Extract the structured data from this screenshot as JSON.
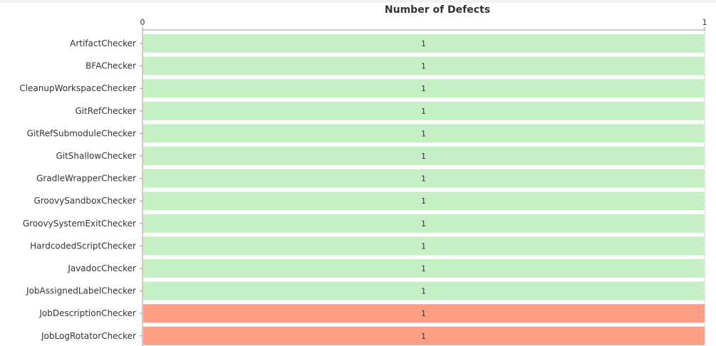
{
  "chart_data": {
    "type": "bar",
    "orientation": "horizontal",
    "xlabel": "Number of Defects",
    "xlim": [
      0,
      1
    ],
    "ticks": [
      "0",
      "1"
    ],
    "grid": false,
    "categories": [
      "ArtifactChecker",
      "BFAChecker",
      "CleanupWorkspaceChecker",
      "GitRefChecker",
      "GitRefSubmoduleChecker",
      "GitShallowChecker",
      "GradleWrapperChecker",
      "GroovySandboxChecker",
      "GroovySystemExitChecker",
      "HardcodedScriptChecker",
      "JavadocChecker",
      "JobAssignedLabelChecker",
      "JobDescriptionChecker",
      "JobLogRotatorChecker"
    ],
    "values": [
      1,
      1,
      1,
      1,
      1,
      1,
      1,
      1,
      1,
      1,
      1,
      1,
      1,
      1
    ],
    "bar_colors": [
      "#c6efc6",
      "#c6efc6",
      "#c6efc6",
      "#c6efc6",
      "#c6efc6",
      "#c6efc6",
      "#c6efc6",
      "#c6efc6",
      "#c6efc6",
      "#c6efc6",
      "#c6efc6",
      "#c6efc6",
      "#fe9f86",
      "#fe9f86"
    ],
    "colors": {
      "green_bar": "#c6efc6",
      "red_bar": "#fe9f86",
      "axis": "#999999"
    }
  }
}
